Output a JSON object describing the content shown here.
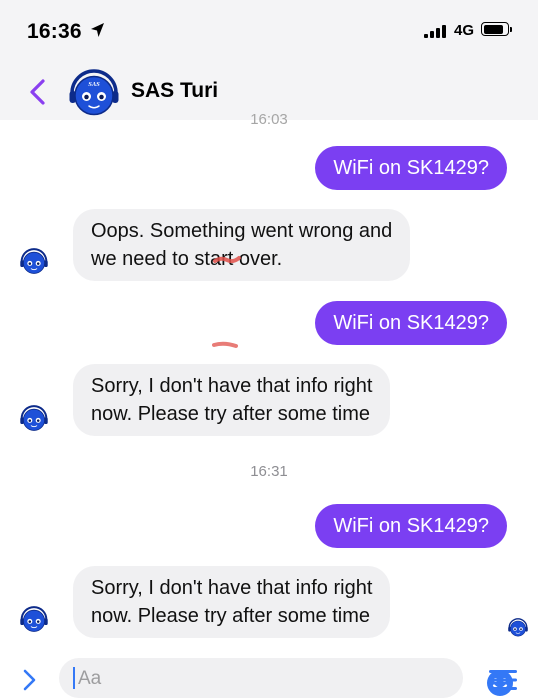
{
  "status_bar": {
    "time": "16:36",
    "network": "4G"
  },
  "header": {
    "contact_name": "SAS Turi",
    "avatar_text": "SAS"
  },
  "conversation": {
    "partial_timestamp": "16:03",
    "timestamp": "16:31",
    "messages": [
      {
        "from": "user",
        "text": "WiFi on SK1429?"
      },
      {
        "from": "bot",
        "lines": [
          "Oops. Something went wrong and",
          "we need to start over."
        ]
      },
      {
        "from": "user",
        "text": "WiFi on SK1429?"
      },
      {
        "from": "bot",
        "lines": [
          "Sorry, I don't have that info right",
          "now. Please try after some time"
        ]
      },
      {
        "from": "user",
        "text": "WiFi on SK1429?"
      },
      {
        "from": "bot",
        "lines": [
          "Sorry, I don't have that info right",
          "now. Please try after some time"
        ]
      }
    ]
  },
  "composer": {
    "placeholder": "Aa"
  },
  "colors": {
    "accent": "#7b3ff2",
    "incoming_bubble": "#f0f0f2",
    "avatar_blue": "#1e50d8",
    "annotation_red": "#e0504a"
  },
  "icons": [
    "location-arrow-icon",
    "signal-icon",
    "battery-icon",
    "back-chevron-icon",
    "expand-chevron-icon",
    "emoji-icon",
    "menu-icon"
  ]
}
